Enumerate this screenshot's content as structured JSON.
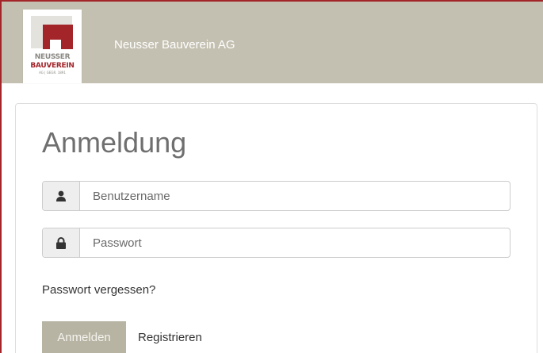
{
  "header": {
    "company_name": "Neusser Bauverein AG",
    "logo": {
      "line1": "NEUSSER",
      "line2": "BAUVEREIN",
      "line3": "AG | GEGR. 1891"
    },
    "background_color": "#c4c0b1",
    "brand_color": "#a3252a"
  },
  "login": {
    "title": "Anmeldung",
    "username": {
      "icon": "user-icon",
      "placeholder": "Benutzername",
      "value": ""
    },
    "password": {
      "icon": "lock-icon",
      "placeholder": "Passwort",
      "value": ""
    },
    "forgot_link": "Passwort vergessen?",
    "login_button": "Anmelden",
    "register_button": "Registrieren"
  }
}
